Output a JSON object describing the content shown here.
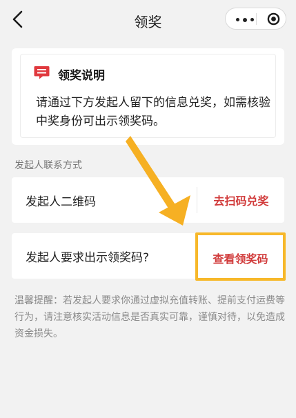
{
  "navbar": {
    "title": "领奖",
    "back_icon": "chevron-left-icon",
    "more_icon": "more-dots-icon",
    "close_icon": "target-close-icon"
  },
  "notice": {
    "icon": "message-icon",
    "title": "领奖说明",
    "body": "请通过下方发起人留下的信息兑奖，如需核验中奖身份可出示领奖码。"
  },
  "contact": {
    "section_label": "发起人联系方式",
    "qr_label": "发起人二维码",
    "qr_action": "去扫码兑奖",
    "code_label": "发起人要求出示领奖码?",
    "code_action": "查看领奖码"
  },
  "tip": "温馨提醒：若发起人要求你通过虚拟充值转账、提前支付运费等行为，请注意核实活动信息是否真实可靠，谨慎对待，以免造成资金损失。",
  "colors": {
    "accent_red": "#d13b3b",
    "highlight_orange": "#f7b82a",
    "arrow_orange": "#f6b023",
    "background": "#f2f2f2"
  }
}
